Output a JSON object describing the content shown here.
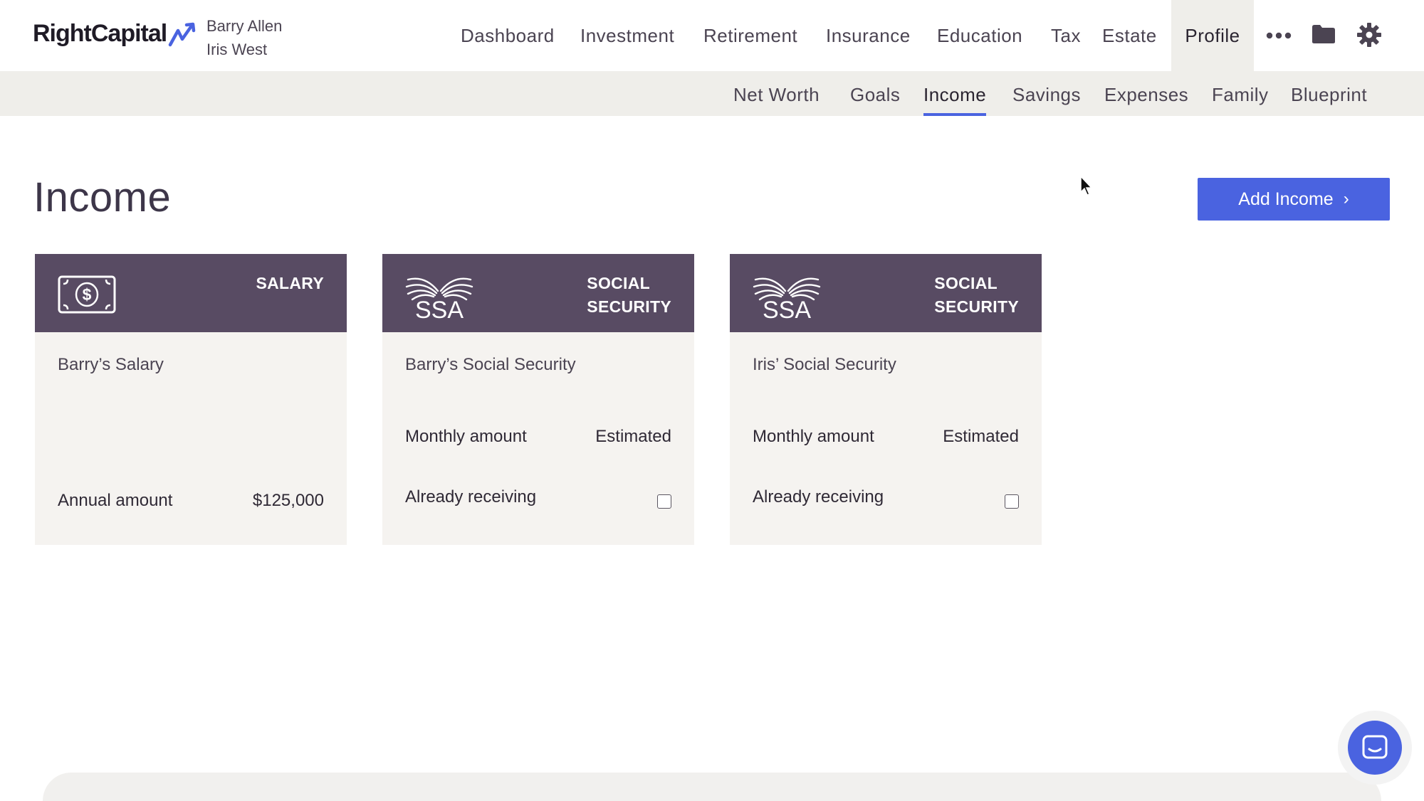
{
  "app": {
    "logo_text": "RightCapital"
  },
  "clients": {
    "primary": "Barry Allen",
    "spouse": "Iris West"
  },
  "main_nav": [
    {
      "label": "Dashboard"
    },
    {
      "label": "Investment"
    },
    {
      "label": "Retirement"
    },
    {
      "label": "Insurance"
    },
    {
      "label": "Education"
    },
    {
      "label": "Tax"
    },
    {
      "label": "Estate"
    },
    {
      "label": "Profile",
      "active": true
    }
  ],
  "toolbar_icons": [
    "more-icon",
    "folder-icon",
    "gear-icon"
  ],
  "sub_nav": [
    {
      "label": "Net Worth"
    },
    {
      "label": "Goals"
    },
    {
      "label": "Income",
      "active": true
    },
    {
      "label": "Savings"
    },
    {
      "label": "Expenses"
    },
    {
      "label": "Family"
    },
    {
      "label": "Blueprint"
    }
  ],
  "page": {
    "title": "Income",
    "add_button": "Add Income"
  },
  "cards": [
    {
      "type": "SALARY",
      "icon": "cash-icon",
      "name": "Barry’s Salary",
      "amount_label": "Annual amount",
      "amount_value": "$125,000"
    },
    {
      "type_line1": "SOCIAL",
      "type_line2": "SECURITY",
      "icon": "ssa-logo",
      "logo_text": "SSA",
      "name": "Barry’s Social Security",
      "amount_label": "Monthly amount",
      "amount_value": "Estimated",
      "receiving_label": "Already receiving",
      "receiving_checked": false
    },
    {
      "type_line1": "SOCIAL",
      "type_line2": "SECURITY",
      "icon": "ssa-logo",
      "logo_text": "SSA",
      "name": "Iris’ Social Security",
      "amount_label": "Monthly amount",
      "amount_value": "Estimated",
      "receiving_label": "Already receiving",
      "receiving_checked": false
    }
  ],
  "colors": {
    "accent": "#4a63e0",
    "card_header": "#584b63",
    "card_body": "#f5f3f0",
    "subnav_bg": "#efeeea"
  }
}
